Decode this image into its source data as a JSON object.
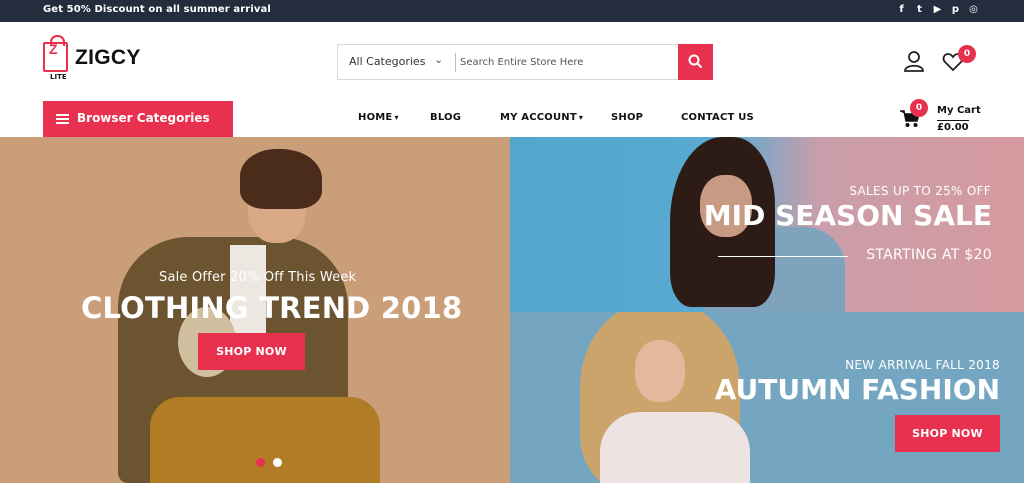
{
  "topbar": {
    "promo": "Get 50% Discount on all summer arrival",
    "social": [
      {
        "icon": "facebook-icon",
        "glyph": "f"
      },
      {
        "icon": "twitter-icon",
        "glyph": "t"
      },
      {
        "icon": "youtube-icon",
        "glyph": "▶"
      },
      {
        "icon": "pinterest-icon",
        "glyph": "p"
      },
      {
        "icon": "instagram-icon",
        "glyph": "◎"
      }
    ]
  },
  "brand": {
    "name": "ZIGCY",
    "tag": "LITE",
    "mark": "Z"
  },
  "search": {
    "category": "All Categories",
    "placeholder": "Search Entire Store Here"
  },
  "header": {
    "wishlist_count": "0"
  },
  "nav": {
    "browse_label": "Browser Categories",
    "items": [
      "HOME",
      "BLOG",
      "MY ACCOUNT",
      "SHOP",
      "CONTACT US"
    ]
  },
  "cart": {
    "count": "0",
    "label": "My Cart",
    "amount": "£0.00"
  },
  "hero": {
    "left": {
      "subtitle": "Sale Offer 20% Off This Week",
      "title": "CLOTHING TREND 2018",
      "button": "SHOP NOW"
    },
    "right_top": {
      "subtitle": "SALES UP TO 25% OFF",
      "title": "MID SEASON SALE",
      "caption": "STARTING AT $20"
    },
    "right_bottom": {
      "subtitle": "NEW ARRIVAL FALL 2018",
      "title": "AUTUMN FASHION",
      "button": "SHOP NOW"
    }
  },
  "colors": {
    "accent": "#e8304f",
    "topbar": "#232d3d"
  }
}
